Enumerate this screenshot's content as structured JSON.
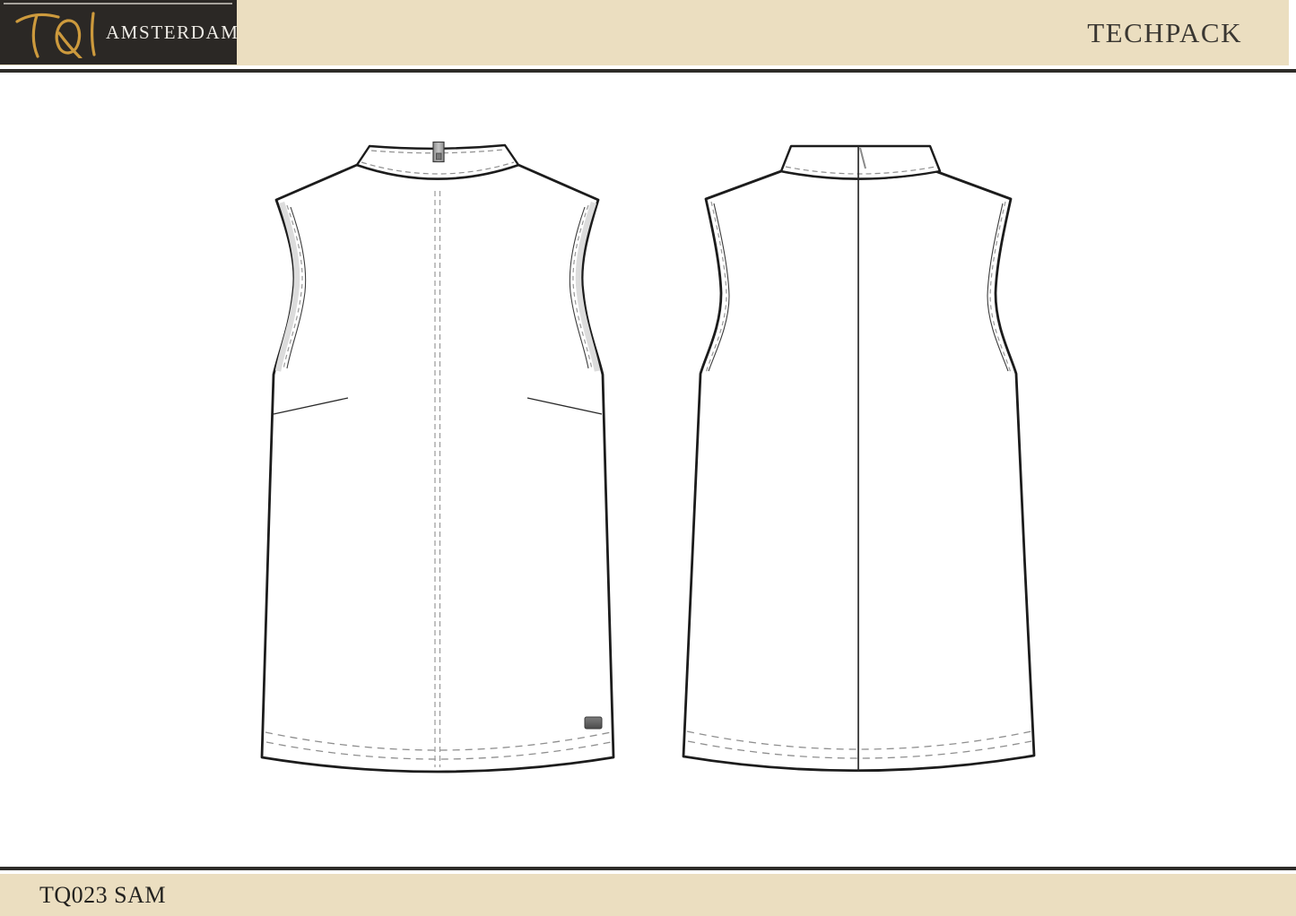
{
  "header": {
    "logo_text": "TQ",
    "brand_city": "AMSTERDAM",
    "doc_title": "TECHPACK"
  },
  "footer": {
    "style_code": "TQ023 SAM"
  },
  "drawing": {
    "views": [
      "front",
      "back"
    ],
    "garment": "sleeveless mock-neck top technical flat",
    "details": [
      "center-front zipper stitching",
      "collar zipper pull",
      "bust darts",
      "armhole binding stitching",
      "double-needle hem stitching",
      "center-back seam",
      "side hem label tag"
    ]
  },
  "colors": {
    "band_cream": "#ebdec0",
    "logo_box_dark": "#2b2825",
    "logo_gold": "#cd9a3d",
    "rule_dark": "#2e2c29",
    "outline_dark": "#1c1c1c",
    "stitch_gray": "#8f8f8f",
    "shade_gray": "#d8d8d8"
  }
}
